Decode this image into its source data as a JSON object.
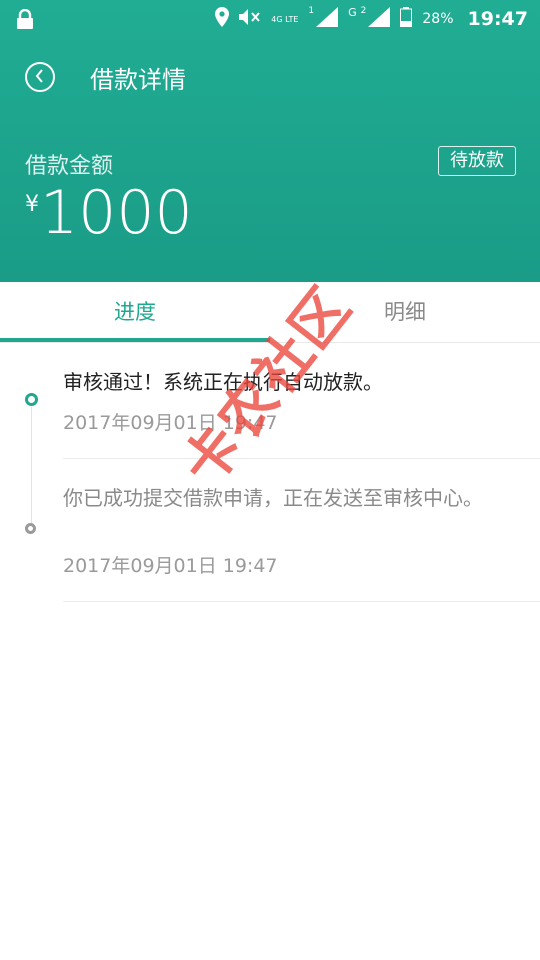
{
  "status_bar": {
    "network_label": "4G LTE",
    "sim1": "1",
    "sim2_type": "G",
    "sim2": "2",
    "battery": "28%",
    "time": "19:47",
    "icons": [
      "lock-icon",
      "location-icon",
      "mute-icon",
      "signal-icon",
      "battery-icon"
    ]
  },
  "app_bar": {
    "title": "借款详情",
    "back_icon": "chevron-left-icon"
  },
  "summary": {
    "amount_label": "借款金额",
    "status": "待放款",
    "currency": "¥",
    "amount": "1000"
  },
  "tabs": [
    {
      "label": "进度",
      "active": true
    },
    {
      "label": "明细",
      "active": false
    }
  ],
  "timeline": [
    {
      "text": "审核通过！系统正在执行自动放款。",
      "time": "2017年09月01日 19:47",
      "active": true
    },
    {
      "text": "你已成功提交借款申请，正在发送至审核中心。",
      "time": "2017年09月01日 19:47",
      "active": false
    }
  ],
  "watermark": "卡农社区",
  "colors": {
    "header": "#1fa88f",
    "accent": "#1fa88f",
    "watermark": "#eb463c"
  }
}
